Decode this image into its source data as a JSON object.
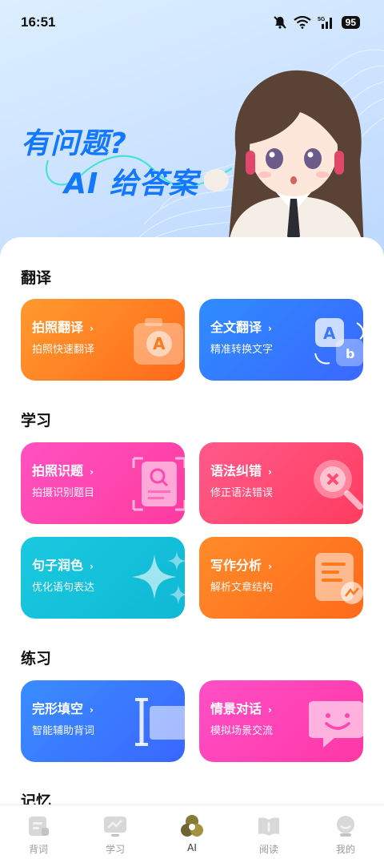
{
  "status": {
    "time": "16:51",
    "battery": "95",
    "network": "5G"
  },
  "hero": {
    "line1": "有问题?",
    "line2": "AI 给答案"
  },
  "sections": {
    "translate": "翻译",
    "study": "学习",
    "practice": "练习",
    "memory": "记忆"
  },
  "cards": {
    "photo_translate": {
      "title": "拍照翻译",
      "subtitle": "拍照快速翻译",
      "arrow": "›"
    },
    "full_translate": {
      "title": "全文翻译",
      "subtitle": "精准转换文字",
      "arrow": "›"
    },
    "photo_question": {
      "title": "拍照识题",
      "subtitle": "拍摄识别题目",
      "arrow": "›"
    },
    "grammar": {
      "title": "语法纠错",
      "subtitle": "修正语法错误",
      "arrow": "›"
    },
    "polish": {
      "title": "句子润色",
      "subtitle": "优化语句表达",
      "arrow": "›"
    },
    "writing": {
      "title": "写作分析",
      "subtitle": "解析文章结构",
      "arrow": "›"
    },
    "cloze": {
      "title": "完形填空",
      "subtitle": "智能辅助背词",
      "arrow": "›"
    },
    "dialogue": {
      "title": "情景对话",
      "subtitle": "模拟场景交流",
      "arrow": "›"
    }
  },
  "tabs": [
    {
      "label": "背词",
      "icon": "card-icon",
      "active": false
    },
    {
      "label": "学习",
      "icon": "monitor-icon",
      "active": false
    },
    {
      "label": "AI",
      "icon": "ai-icon",
      "active": true
    },
    {
      "label": "阅读",
      "icon": "book-icon",
      "active": false
    },
    {
      "label": "我的",
      "icon": "profile-icon",
      "active": false
    }
  ],
  "colors": {
    "brand_blue": "#1478ff",
    "orange": "#ff7a1a",
    "blue": "#3a7aff",
    "pink": "#ff45b0",
    "red": "#ff4a72",
    "cyan": "#14c0da"
  }
}
